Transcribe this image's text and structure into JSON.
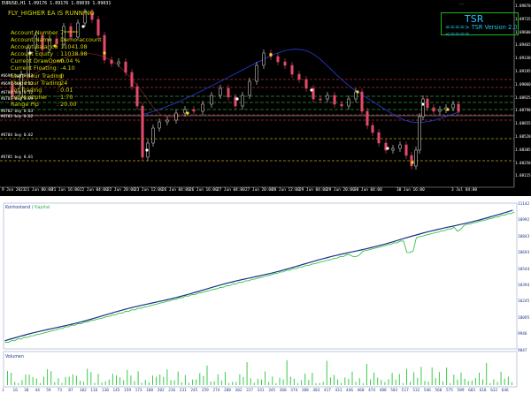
{
  "price_chart": {
    "symbol_line": "EURUSD,H1  1.09176 1.09176 1.09039 1.09031",
    "ea_title": "FLY_HIGHER EA IS RUNNING",
    "info_rows": [
      {
        "label": "Account Number",
        "value": ": 7*****"
      },
      {
        "label": "Account Name",
        "value": ": Demo account"
      },
      {
        "label": "Account Balance",
        "value": ": 11041.08"
      },
      {
        "label": "Account Equity",
        "value": ": 11038.98"
      },
      {
        "label": "Current DrawDown",
        "value": ": 0.04 %"
      },
      {
        "label": "Current Floating",
        "value": ": -4.10"
      },
      {
        "label": "Start Hour Trading",
        "value": ": 0"
      },
      {
        "label": "Stop Hour Trading",
        "value": ": 24"
      },
      {
        "label": "Lot Trading",
        "value": ": 0.01"
      },
      {
        "label": "Lot Multiplier",
        "value": ": 1.70"
      },
      {
        "label": "Range Pip",
        "value": ": 20.00"
      }
    ],
    "level_labels": [
      {
        "text": "#6698 buy 0.13",
        "y": 90
      },
      {
        "text": "#6699 buy 0.12",
        "y": 99
      },
      {
        "text": "#6700 buy 0.12",
        "y": 109
      },
      {
        "text": "#6701 buy 0.09",
        "y": 116
      },
      {
        "text": "#6702 buy 0.03",
        "y": 130
      },
      {
        "text": "#6703 buy 0.02",
        "y": 136
      },
      {
        "text": "#6704 buy 0.02",
        "y": 157
      },
      {
        "text": "#6705 buy 0.01",
        "y": 182
      }
    ],
    "tsr_corner": "---",
    "tsr_title": "TSR",
    "tsr_version": "====> TSR Version 2.0 <====",
    "y_ticks": [
      "1.09870",
      "1.09735",
      "1.09600",
      "1.09465",
      "1.09330",
      "1.09195",
      "1.09060",
      "1.08925",
      "1.08790",
      "1.08655",
      "1.08520",
      "1.08385",
      "1.08250",
      "1.08115"
    ],
    "x_ticks": [
      "9 Jun 2023",
      "21 Jun 00:00",
      "21 Jun 16:00",
      "22 Jun 04:00",
      "22 Jun 20:00",
      "23 Jun 12:00",
      "26 Jun 04:00",
      "26 Jun 16:00",
      "27 Jun 04:00",
      "27 Jun 20:00",
      "28 Jun 12:00",
      "29 Jun 04:00",
      "29 Jun 20:00",
      "30 Jun 04:00",
      "30 Jun 16:00",
      "3 Jul 04:00"
    ]
  },
  "equity_chart": {
    "legend_balance": "Kontostand",
    "legend_sep": " / ",
    "legend_equity": "Kapital",
    "volume_label": "Volumen",
    "y_ticks": [
      "11142",
      "10992",
      "10843",
      "10693",
      "10544",
      "10394",
      "10245",
      "10095",
      "9946",
      "9847"
    ],
    "x_ticks": [
      "1",
      "16",
      "30",
      "44",
      "59",
      "73",
      "87",
      "102",
      "116",
      "130",
      "145",
      "159",
      "173",
      "188",
      "202",
      "216",
      "231",
      "245",
      "259",
      "274",
      "288",
      "302",
      "317",
      "331",
      "345",
      "360",
      "374",
      "388",
      "403",
      "417",
      "431",
      "446",
      "460",
      "474",
      "488",
      "503",
      "517",
      "532",
      "546",
      "560",
      "575",
      "589",
      "603",
      "618",
      "632",
      "646"
    ],
    "colors": {
      "balance": "#1a2f86",
      "equity": "#34c14a",
      "volume": "#3ccb4a"
    }
  },
  "chart_data": {
    "type": "line",
    "title": "",
    "xlabel": "",
    "ylabel": "",
    "ylim": [
      9847,
      11142
    ],
    "series": [
      {
        "name": "Kontostand",
        "x": [
          1,
          100,
          200,
          300,
          400,
          500,
          600,
          646
        ],
        "values": [
          9900,
          10200,
          10400,
          10560,
          10700,
          10880,
          11000,
          11110
        ]
      },
      {
        "name": "Kapital",
        "x": [
          1,
          100,
          200,
          300,
          400,
          500,
          512,
          520,
          600,
          646
        ],
        "values": [
          9900,
          10200,
          10400,
          10550,
          10690,
          10860,
          10720,
          10850,
          10990,
          11100
        ]
      }
    ]
  }
}
